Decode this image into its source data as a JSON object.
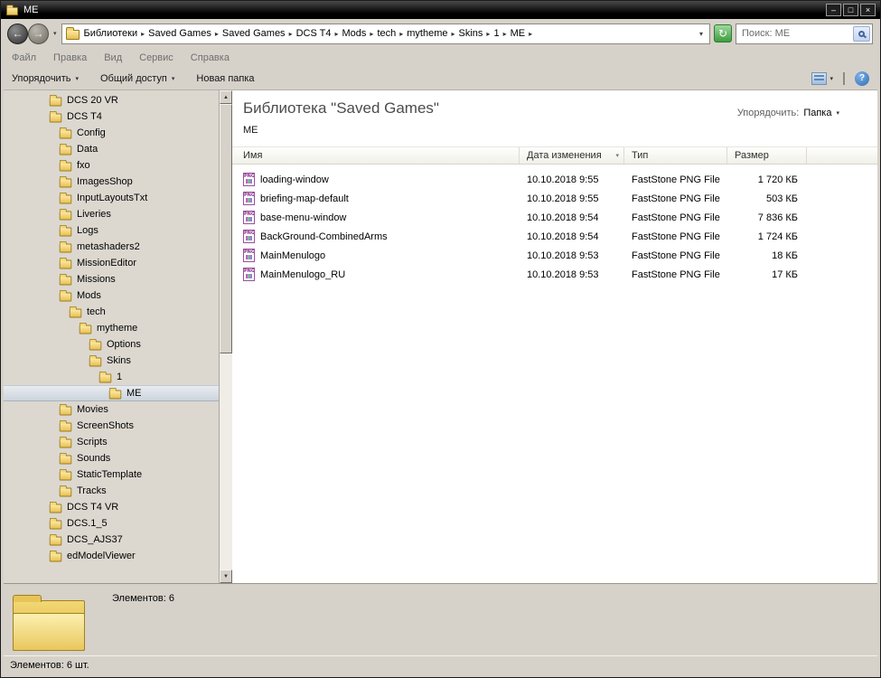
{
  "window": {
    "title": "ME"
  },
  "icons": {
    "minimize": "–",
    "maximize": "□",
    "close": "×",
    "back": "←",
    "forward": "→",
    "refresh": "↻",
    "dropdown": "▾",
    "crumb_sep": "▸",
    "scroll_up": "▲",
    "scroll_down": "▼",
    "help": "?"
  },
  "colors": {
    "chrome": "#d6d2ca",
    "titlebar": "#000000",
    "selection": "#ccd4dc",
    "refresh_green": "#3f9b3f",
    "png_icon_purple": "#9b4f9b"
  },
  "address_bar": {
    "breadcrumbs": [
      "Библиотеки",
      "Saved Games",
      "Saved Games",
      "DCS T4",
      "Mods",
      "tech",
      "mytheme",
      "Skins",
      "1",
      "ME"
    ],
    "search_text": "Поиск: ME"
  },
  "menu_bar": {
    "items": [
      "Файл",
      "Правка",
      "Вид",
      "Сервис",
      "Справка"
    ]
  },
  "toolbar": {
    "buttons": [
      {
        "label": "Упорядочить",
        "dropdown": true
      },
      {
        "label": "Общий доступ",
        "dropdown": true
      },
      {
        "label": "Новая папка",
        "dropdown": false
      }
    ]
  },
  "tree": {
    "items": [
      {
        "label": "DCS 20 VR",
        "level": 0
      },
      {
        "label": "DCS T4",
        "level": 0
      },
      {
        "label": "Config",
        "level": 1
      },
      {
        "label": "Data",
        "level": 1
      },
      {
        "label": "fxo",
        "level": 1
      },
      {
        "label": "ImagesShop",
        "level": 1
      },
      {
        "label": "InputLayoutsTxt",
        "level": 1
      },
      {
        "label": "Liveries",
        "level": 1
      },
      {
        "label": "Logs",
        "level": 1
      },
      {
        "label": "metashaders2",
        "level": 1
      },
      {
        "label": "MissionEditor",
        "level": 1
      },
      {
        "label": "Missions",
        "level": 1
      },
      {
        "label": "Mods",
        "level": 1
      },
      {
        "label": "tech",
        "level": 2
      },
      {
        "label": "mytheme",
        "level": 3
      },
      {
        "label": "Options",
        "level": 4
      },
      {
        "label": "Skins",
        "level": 4
      },
      {
        "label": "1",
        "level": 5
      },
      {
        "label": "ME",
        "level": 6,
        "selected": true
      },
      {
        "label": "Movies",
        "level": 1
      },
      {
        "label": "ScreenShots",
        "level": 1
      },
      {
        "label": "Scripts",
        "level": 1
      },
      {
        "label": "Sounds",
        "level": 1
      },
      {
        "label": "StaticTemplate",
        "level": 1
      },
      {
        "label": "Tracks",
        "level": 1
      },
      {
        "label": "DCS T4 VR",
        "level": 0
      },
      {
        "label": "DCS.1_5",
        "level": 0
      },
      {
        "label": "DCS_AJS37",
        "level": 0
      },
      {
        "label": "edModelViewer",
        "level": 0
      }
    ]
  },
  "content": {
    "library_title": "Библиотека \"Saved Games\"",
    "library_subtitle": "ME",
    "arrange_label": "Упорядочить:",
    "arrange_value": "Папка",
    "columns": [
      "Имя",
      "Дата изменения",
      "Тип",
      "Размер"
    ],
    "files": [
      {
        "name": "loading-window",
        "date": "10.10.2018 9:55",
        "type": "FastStone PNG File",
        "size": "1 720 КБ"
      },
      {
        "name": "briefing-map-default",
        "date": "10.10.2018 9:55",
        "type": "FastStone PNG File",
        "size": "503 КБ"
      },
      {
        "name": "base-menu-window",
        "date": "10.10.2018 9:54",
        "type": "FastStone PNG File",
        "size": "7 836 КБ"
      },
      {
        "name": "BackGround-CombinedArms",
        "date": "10.10.2018 9:54",
        "type": "FastStone PNG File",
        "size": "1 724 КБ"
      },
      {
        "name": "MainMenulogo",
        "date": "10.10.2018 9:53",
        "type": "FastStone PNG File",
        "size": "18 КБ"
      },
      {
        "name": "MainMenulogo_RU",
        "date": "10.10.2018 9:53",
        "type": "FastStone PNG File",
        "size": "17 КБ"
      }
    ]
  },
  "details_pane": {
    "items_count": "Элементов: 6"
  },
  "status_bar": {
    "text": "Элементов: 6 шт."
  }
}
